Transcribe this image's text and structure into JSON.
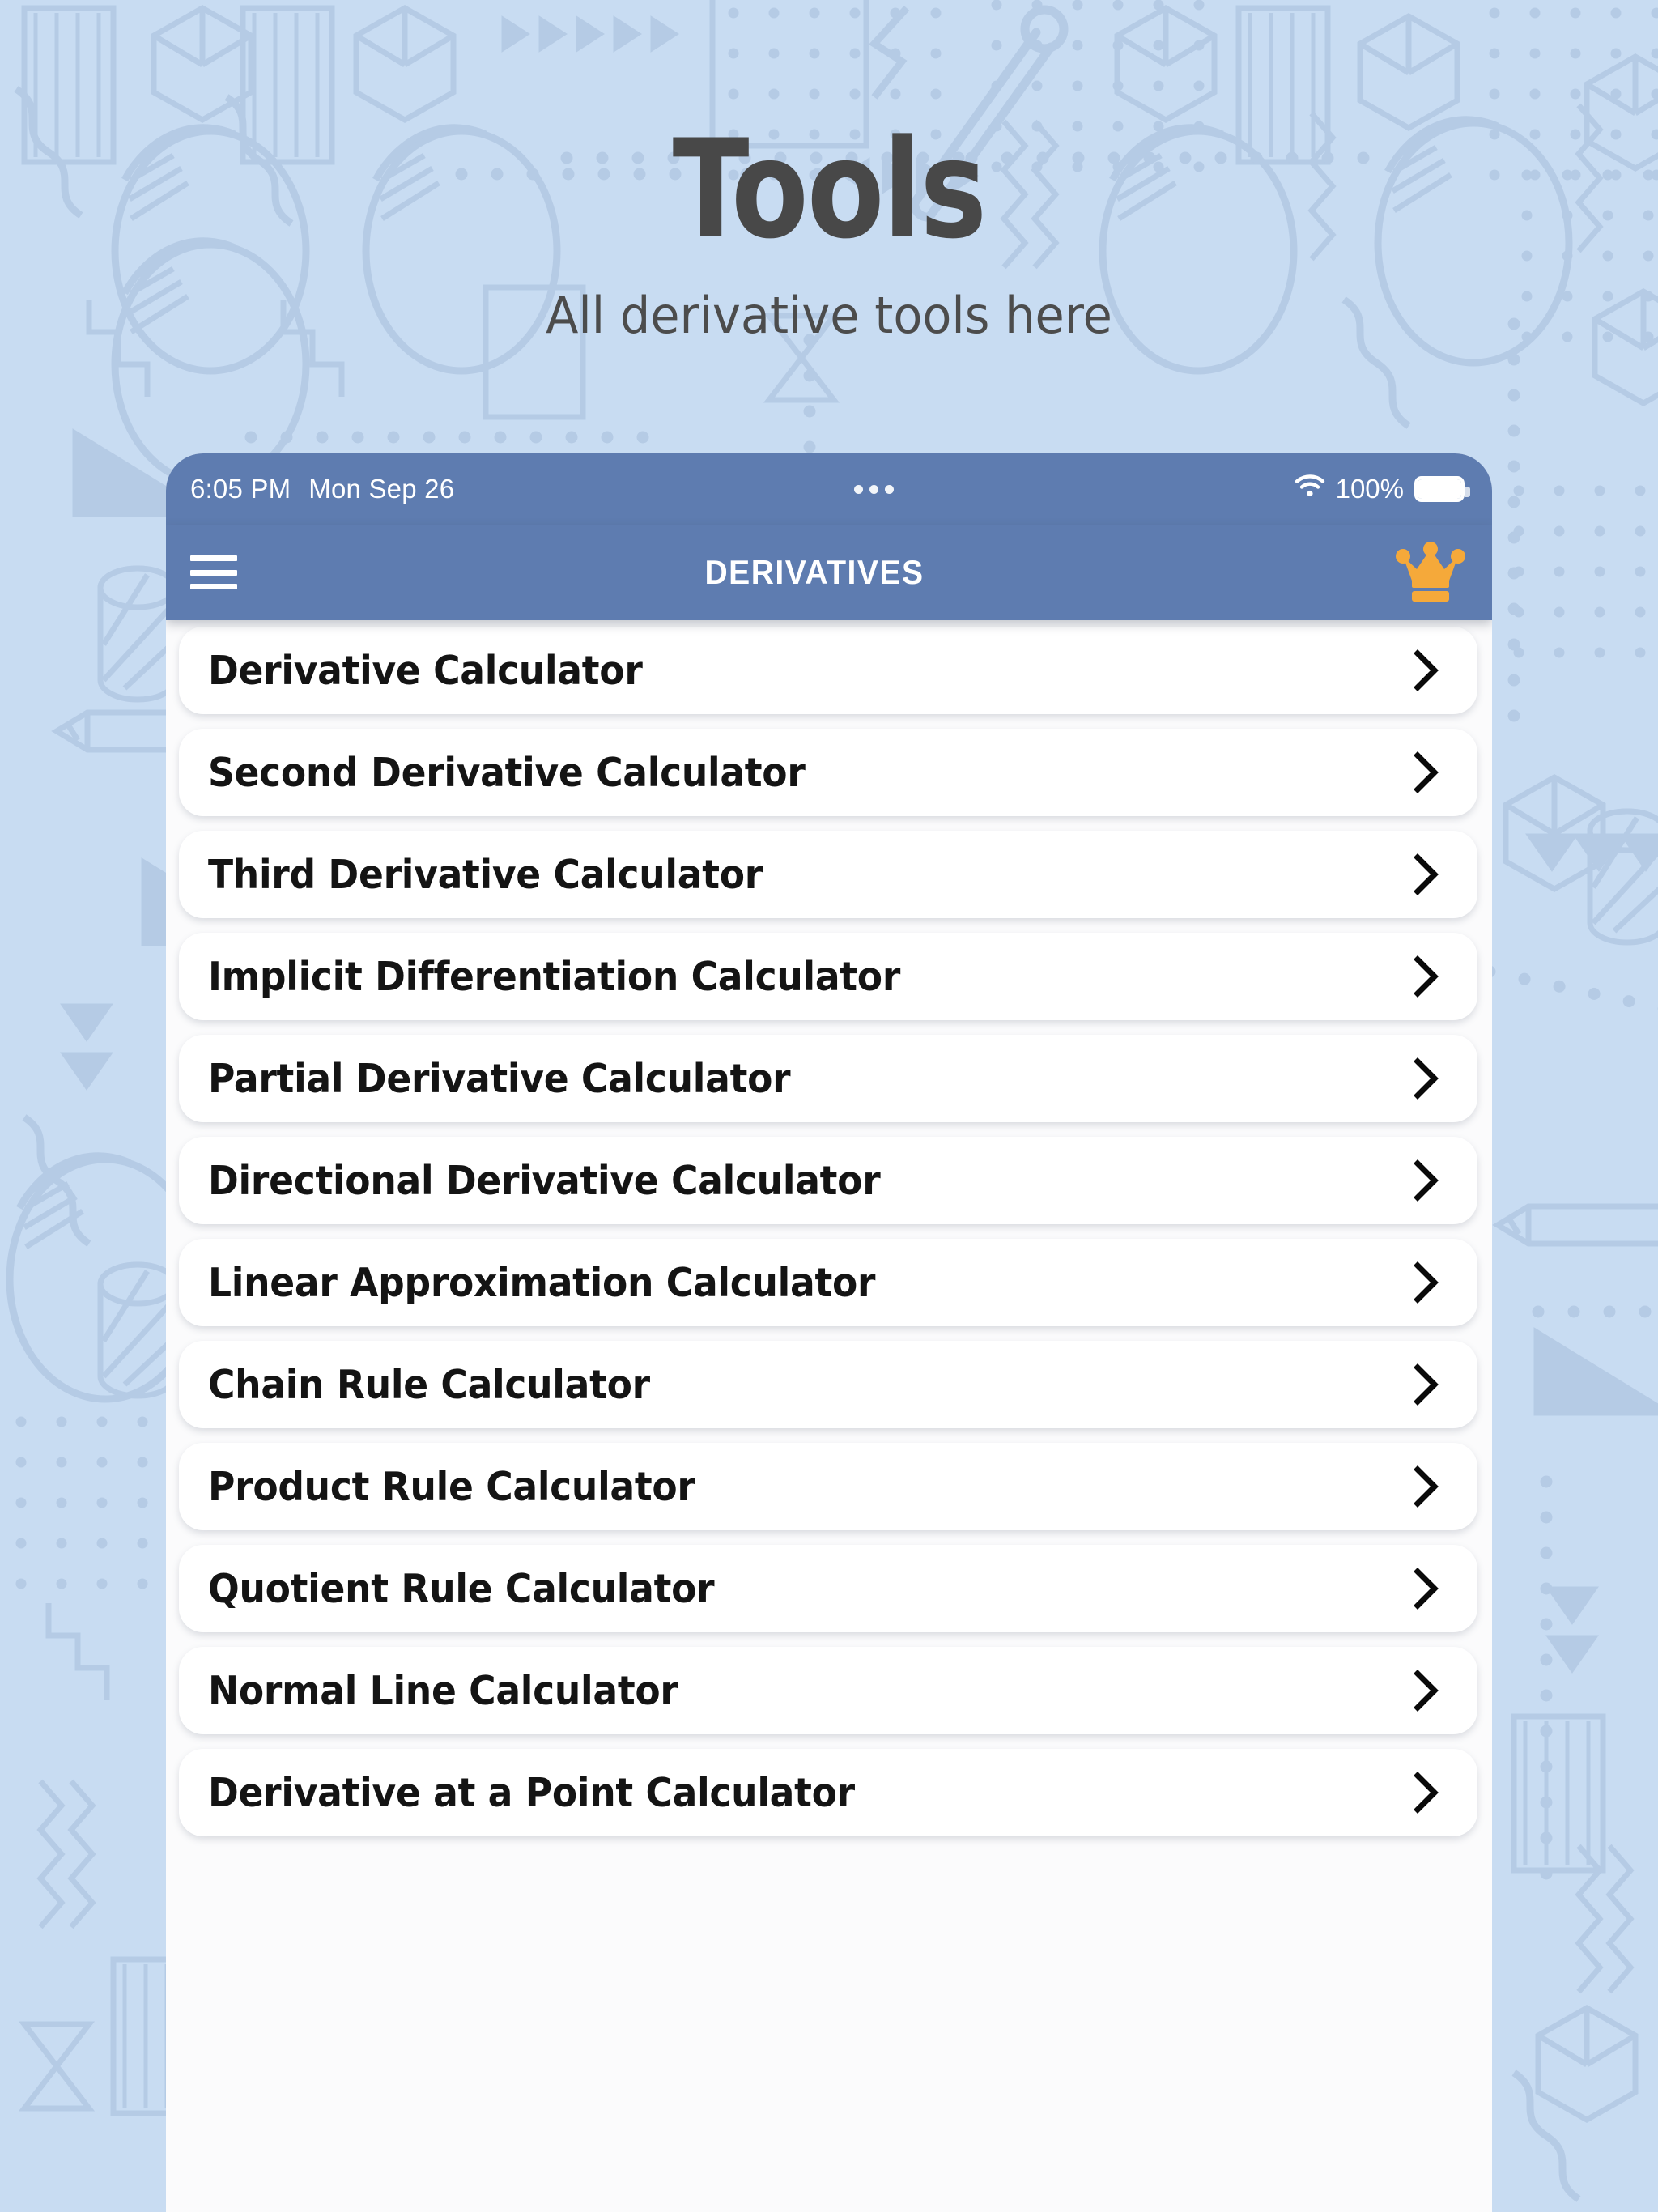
{
  "hero": {
    "title": "Tools",
    "subtitle": "All derivative tools here"
  },
  "colors": {
    "page_background": "#c8dcf2",
    "pattern_stroke": "#b3c8e2",
    "app_bar": "#5e7cb0",
    "crown": "#f5a93a",
    "card": "#ffffff",
    "card_text": "#141414",
    "hero_text": "#484848"
  },
  "status_bar": {
    "time": "6:05 PM",
    "date": "Mon Sep 26",
    "wifi_icon": "wifi-icon",
    "battery_percent": "100%",
    "battery_icon": "battery-full-icon",
    "center_dots": "camera-dots-indicator"
  },
  "app_bar": {
    "menu_icon": "hamburger-menu-icon",
    "title": "DERIVATIVES",
    "premium_icon": "crown-icon"
  },
  "tool_list": {
    "chevron_icon": "chevron-right-icon",
    "items": [
      {
        "label": "Derivative Calculator"
      },
      {
        "label": "Second Derivative Calculator"
      },
      {
        "label": "Third Derivative Calculator"
      },
      {
        "label": "Implicit Differentiation Calculator"
      },
      {
        "label": "Partial Derivative Calculator"
      },
      {
        "label": "Directional Derivative Calculator"
      },
      {
        "label": "Linear Approximation Calculator"
      },
      {
        "label": "Chain Rule Calculator"
      },
      {
        "label": "Product Rule Calculator"
      },
      {
        "label": "Quotient Rule Calculator"
      },
      {
        "label": "Normal Line Calculator"
      },
      {
        "label": "Derivative at a Point Calculator"
      }
    ]
  }
}
